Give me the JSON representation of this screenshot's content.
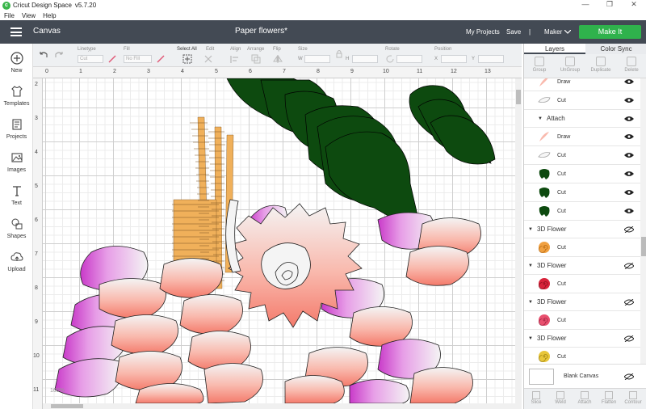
{
  "titlebar": {
    "app_name": "Cricut Design Space",
    "version": "v5.7.20",
    "minimize": "—",
    "maximize": "❐",
    "close": "✕"
  },
  "menubar": {
    "items": [
      "File",
      "View",
      "Help"
    ]
  },
  "header": {
    "section": "Canvas",
    "doc_title": "Paper flowers*",
    "my_projects": "My Projects",
    "save": "Save",
    "separator": "|",
    "machine": "Maker",
    "make_it": "Make It"
  },
  "leftbar": {
    "tools": [
      {
        "label": "New",
        "icon": "plus-circle-icon"
      },
      {
        "label": "Templates",
        "icon": "shirt-icon"
      },
      {
        "label": "Projects",
        "icon": "projects-icon"
      },
      {
        "label": "Images",
        "icon": "image-icon"
      },
      {
        "label": "Text",
        "icon": "text-icon"
      },
      {
        "label": "Shapes",
        "icon": "shapes-icon"
      },
      {
        "label": "Upload",
        "icon": "upload-icon"
      }
    ]
  },
  "toolbar": {
    "linetype_label": "Linetype",
    "linetype_value": "Cut",
    "fill_label": "Fill",
    "fill_value": "No Fill",
    "select_all": "Select All",
    "edit": "Edit",
    "align": "Align",
    "arrange": "Arrange",
    "flip": "Flip",
    "size": "Size",
    "w": "W",
    "h": "H",
    "rotate": "Rotate",
    "position": "Position",
    "x": "X",
    "y": "Y"
  },
  "ruler": {
    "h_ticks": [
      "0",
      "1",
      "2",
      "3",
      "4",
      "5",
      "6",
      "7",
      "8",
      "9",
      "10",
      "11",
      "12",
      "13"
    ],
    "v_ticks": [
      "2",
      "3",
      "4",
      "5",
      "6",
      "7",
      "8",
      "9",
      "10",
      "11"
    ]
  },
  "canvas": {
    "zoom": "100%"
  },
  "panel": {
    "tabs": [
      "Layers",
      "Color Sync"
    ],
    "tools": [
      "Group",
      "UnGroup",
      "Duplicate",
      "Delete"
    ],
    "rows": [
      {
        "kind": "layer",
        "label": "Draw",
        "thumb": "draw-pink"
      },
      {
        "kind": "layer",
        "label": "Cut",
        "thumb": "petal-white"
      },
      {
        "kind": "group",
        "label": "Attach"
      },
      {
        "kind": "layer",
        "label": "Draw",
        "thumb": "draw-pink"
      },
      {
        "kind": "layer",
        "label": "Cut",
        "thumb": "petal-white"
      },
      {
        "kind": "layer",
        "label": "Cut",
        "thumb": "leaf-green"
      },
      {
        "kind": "layer",
        "label": "Cut",
        "thumb": "leaf-green"
      },
      {
        "kind": "layer",
        "label": "Cut",
        "thumb": "leaf-green"
      },
      {
        "kind": "group",
        "label": "3D Flower",
        "hidden": true
      },
      {
        "kind": "layer",
        "label": "Cut",
        "thumb": "spiral-orange"
      },
      {
        "kind": "group",
        "label": "3D Flower",
        "hidden": true
      },
      {
        "kind": "layer",
        "label": "Cut",
        "thumb": "spiral-red"
      },
      {
        "kind": "group",
        "label": "3D Flower",
        "hidden": true
      },
      {
        "kind": "layer",
        "label": "Cut",
        "thumb": "spiral-pink"
      },
      {
        "kind": "group",
        "label": "3D Flower",
        "hidden": true
      },
      {
        "kind": "layer",
        "label": "Cut",
        "thumb": "spiral-yellow"
      }
    ],
    "blank_canvas": "Blank Canvas",
    "bottom_tools": [
      "Slice",
      "Weld",
      "Attach",
      "Flatten",
      "Contour"
    ]
  },
  "colors": {
    "header": "#434a54",
    "make_it": "#2fb24c",
    "leaf": "#0d4a0f",
    "fringe": "#f0b05a",
    "petal_tip_pink": "#f47a6b",
    "petal_tip_magenta": "#c93ac9"
  }
}
